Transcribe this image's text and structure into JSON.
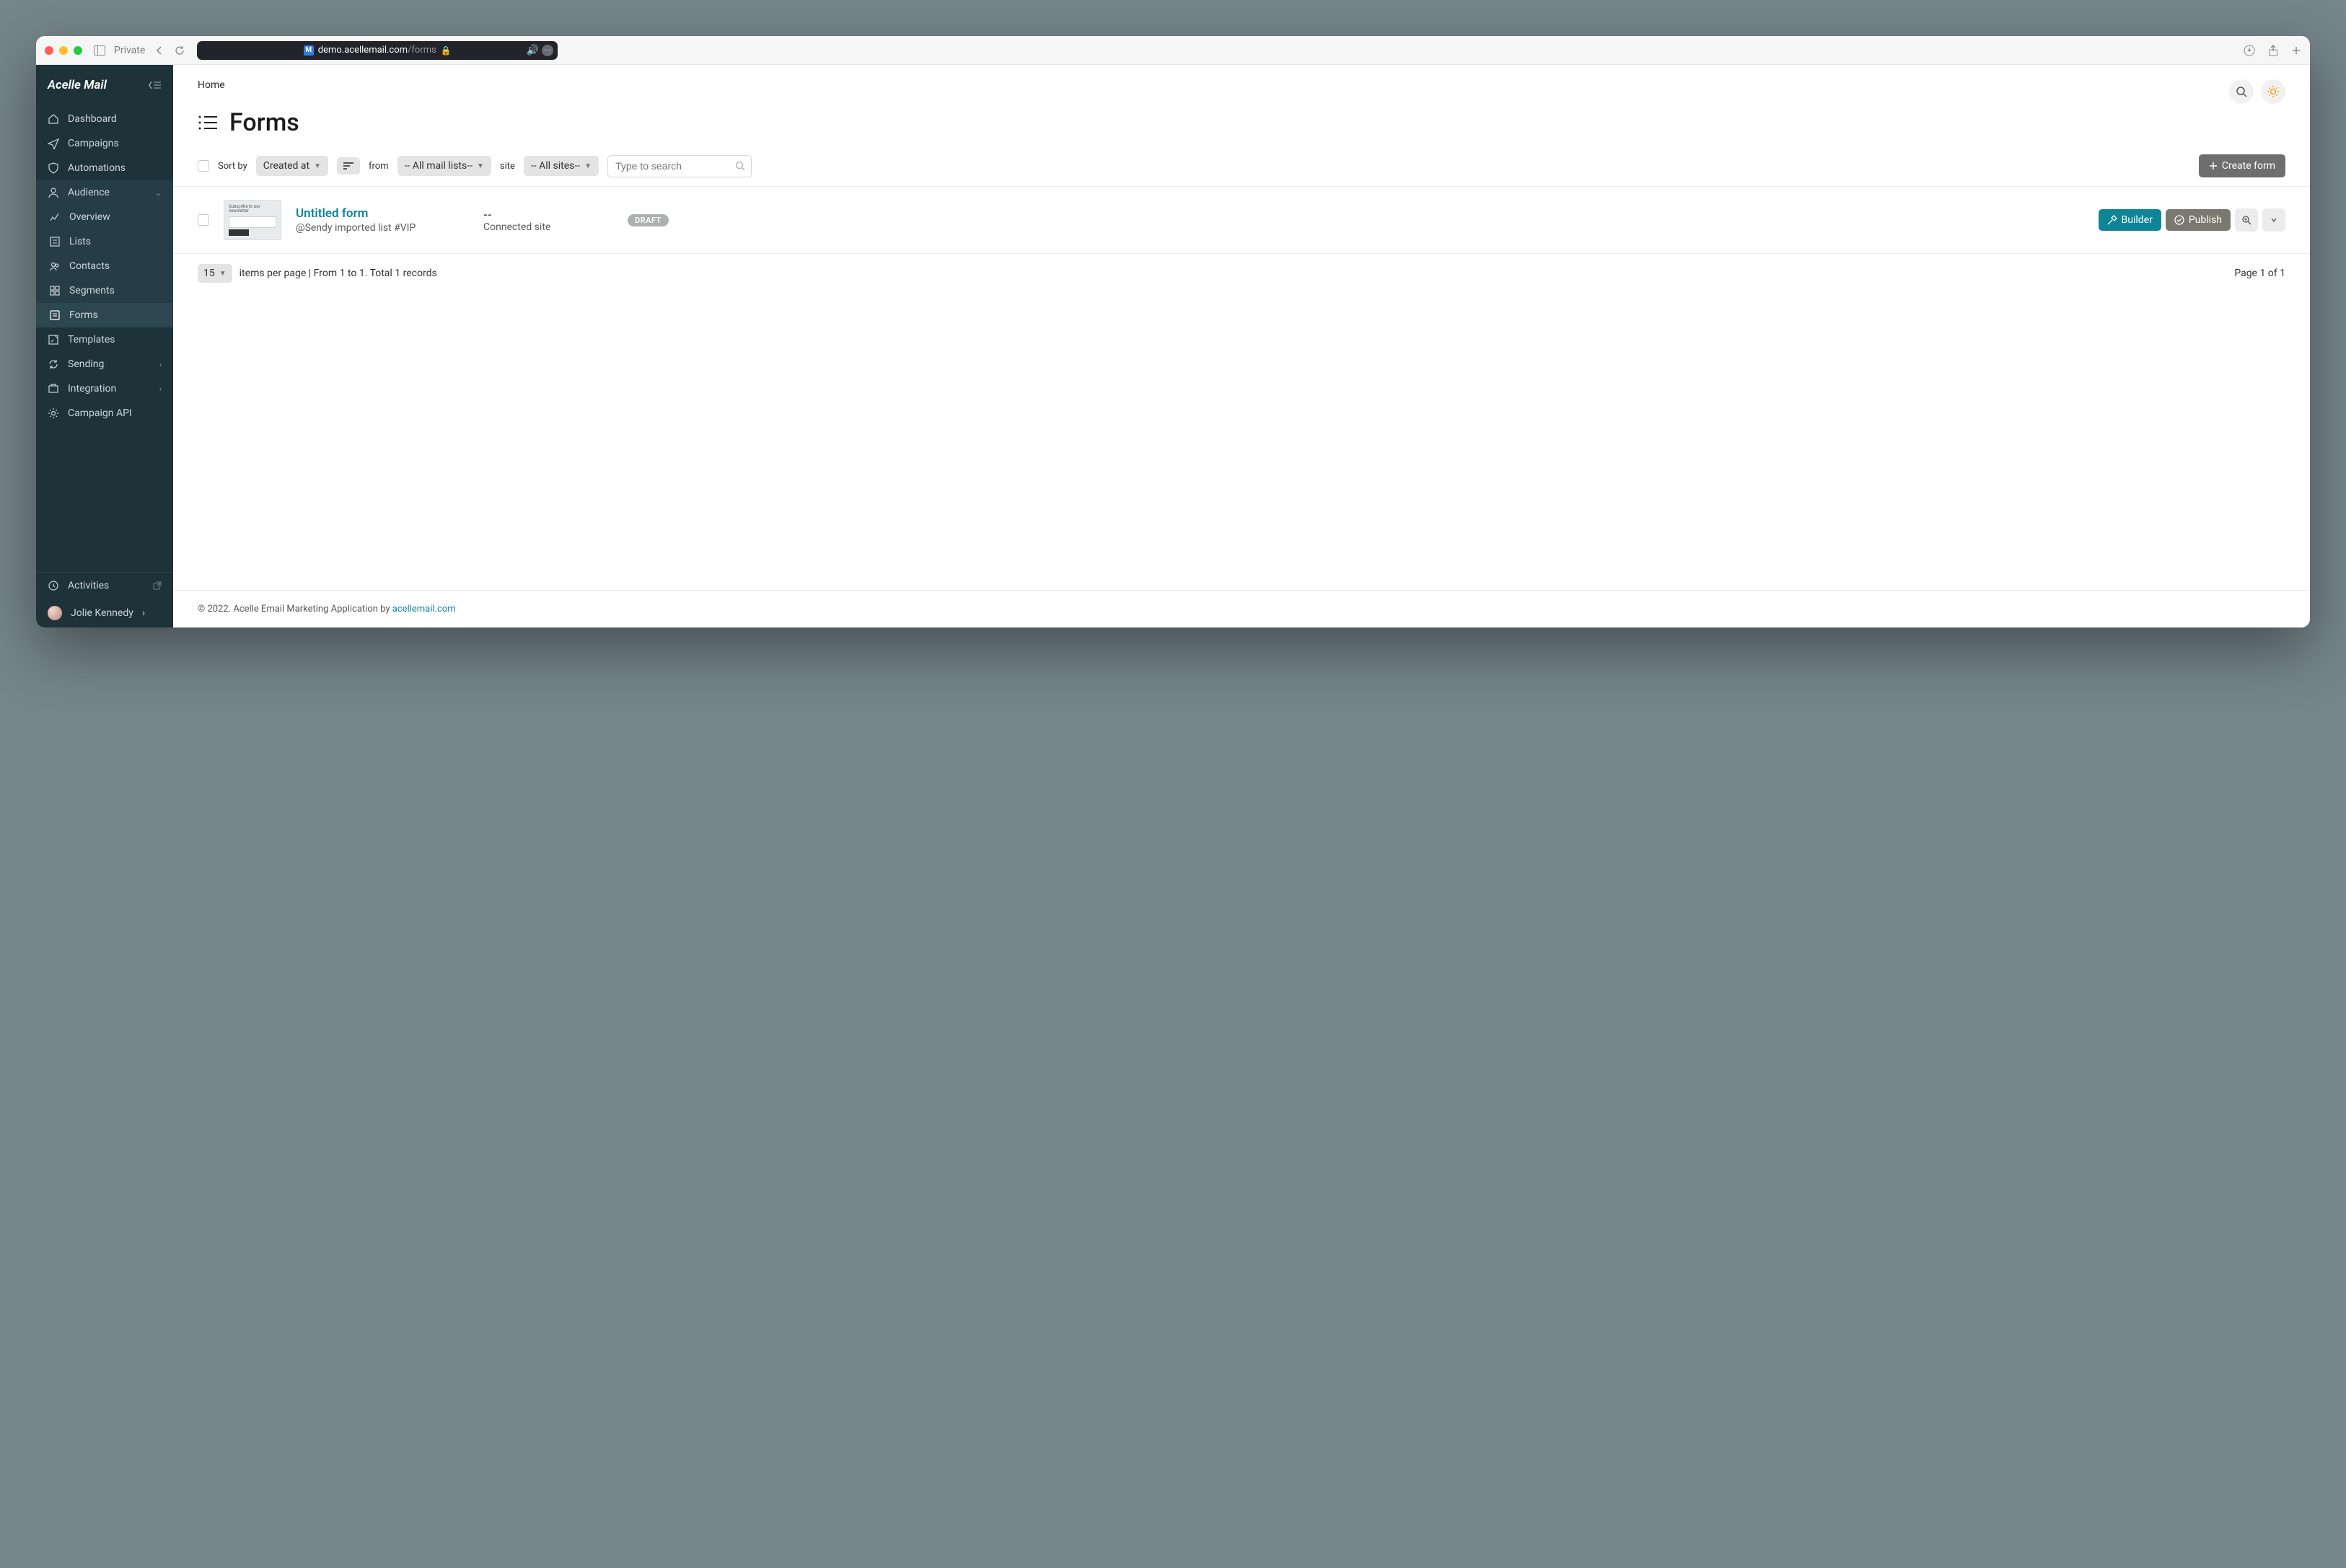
{
  "browser": {
    "private_label": "Private",
    "host": "demo.acellemail.com",
    "path": "/forms"
  },
  "brand": {
    "name": "Acelle Mail"
  },
  "nav": {
    "dashboard": "Dashboard",
    "campaigns": "Campaigns",
    "automations": "Automations",
    "audience": "Audience",
    "overview": "Overview",
    "lists": "Lists",
    "contacts": "Contacts",
    "segments": "Segments",
    "forms": "Forms",
    "templates": "Templates",
    "sending": "Sending",
    "integration": "Integration",
    "campaign_api": "Campaign API",
    "activities": "Activities",
    "user": "Jolie Kennedy"
  },
  "crumb": {
    "home": "Home"
  },
  "page": {
    "title": "Forms"
  },
  "toolbar": {
    "sort_label": "Sort by",
    "sort_value": "Created at",
    "from_label": "from",
    "from_value": "-- All mail lists--",
    "site_label": "site",
    "site_value": "-- All sites--",
    "search_placeholder": "Type to search",
    "create_label": "Create form"
  },
  "rows": [
    {
      "title": "Untitled form",
      "subtitle": "@Sendy imported list #VIP",
      "site_dash": "--",
      "site_label": "Connected site",
      "status": "DRAFT",
      "builder_label": "Builder",
      "publish_label": "Publish"
    }
  ],
  "pager": {
    "per_page": "15",
    "summary": "items per page  | From 1 to 1. Total 1 records",
    "page_label": "Page 1 of 1"
  },
  "footer": {
    "text": "© 2022. Acelle Email Marketing Application by ",
    "link": "acellemail.com"
  }
}
